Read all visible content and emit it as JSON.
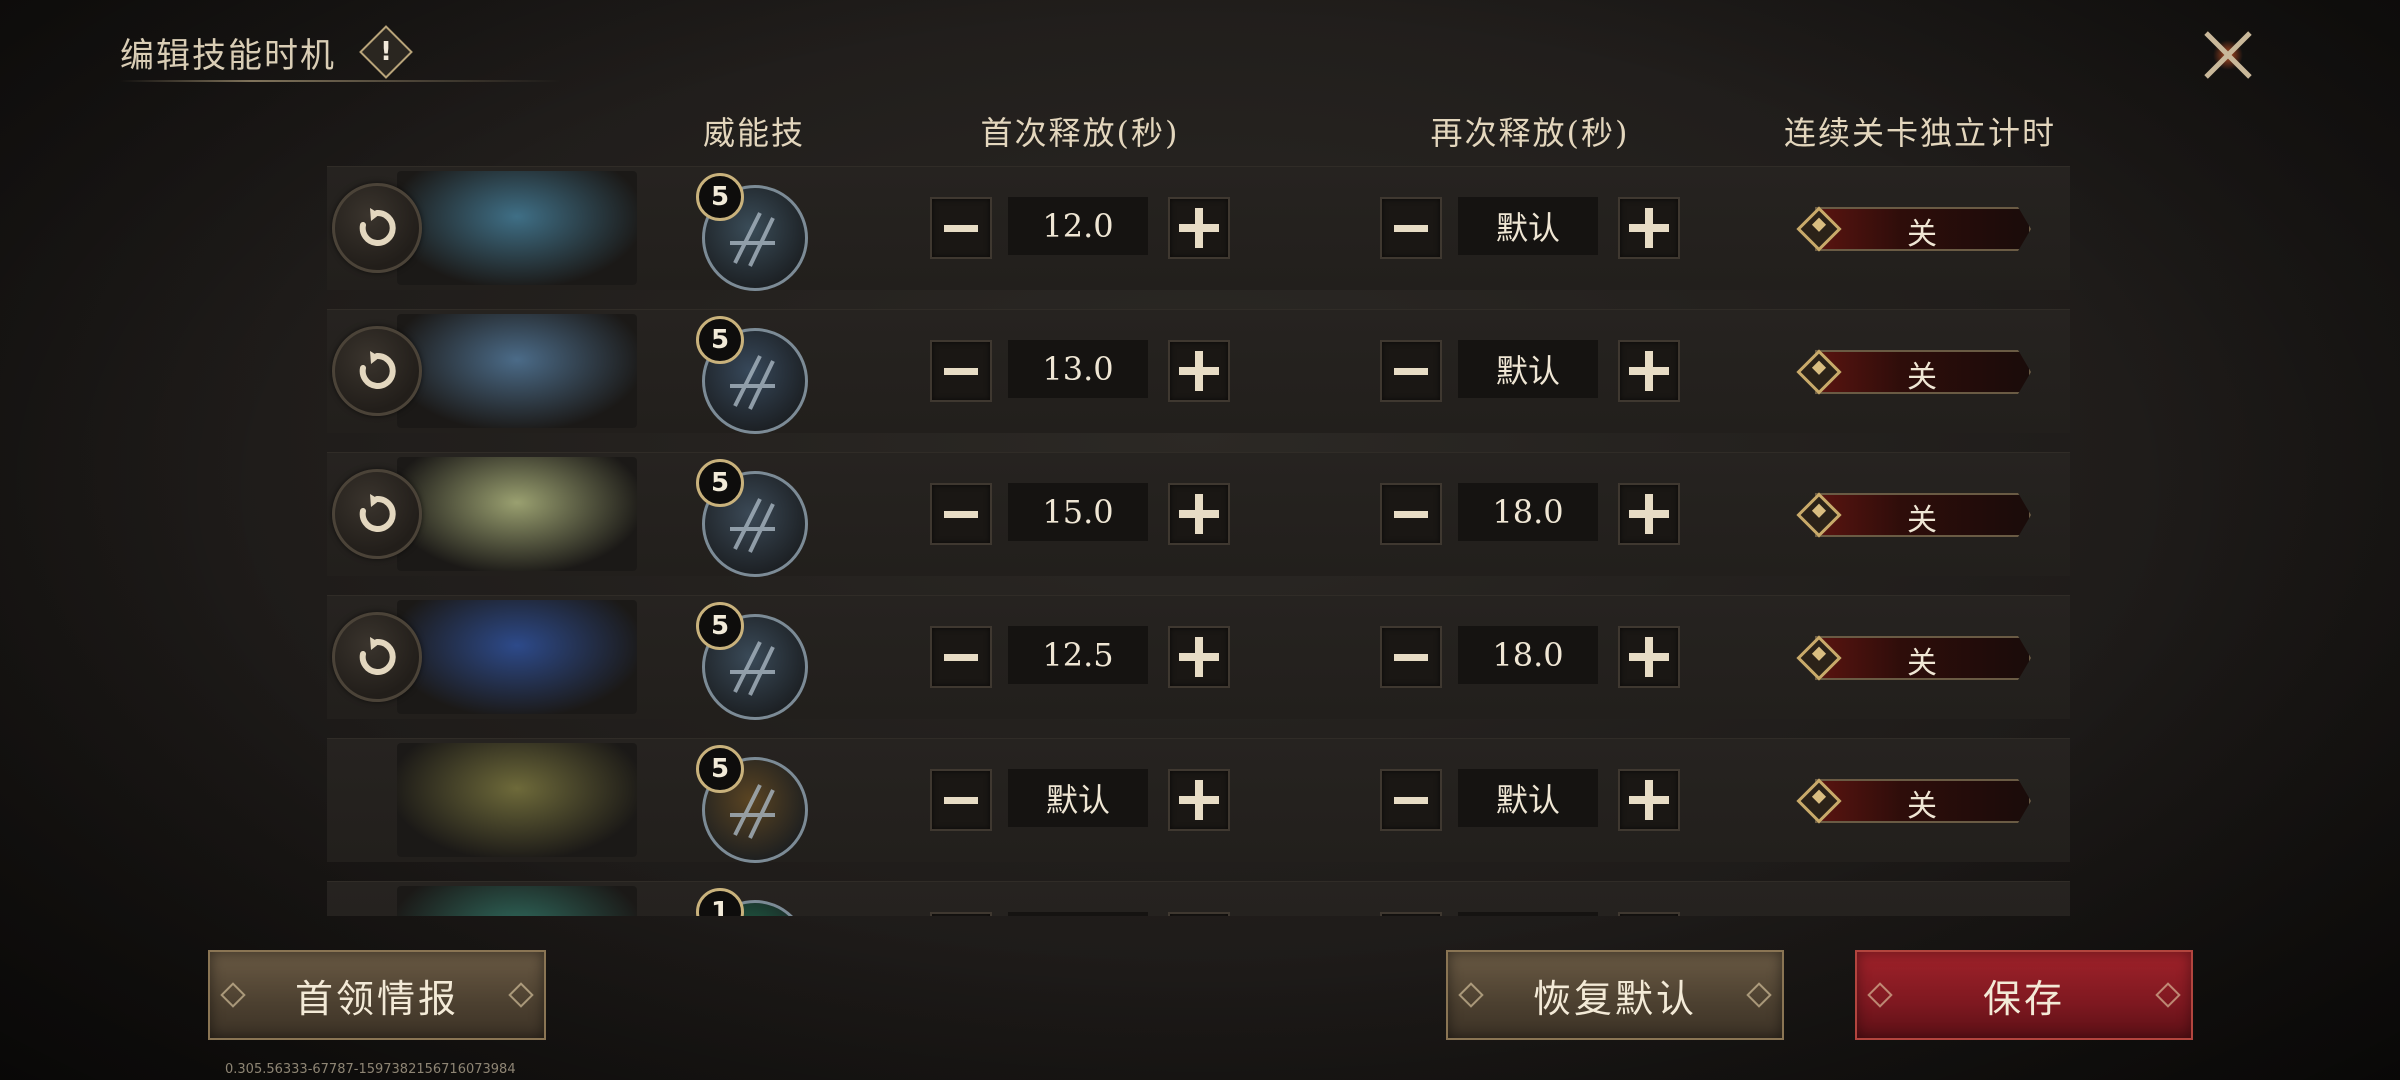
{
  "header": {
    "title": "编辑技能时机",
    "info_mark": "!"
  },
  "columns": {
    "skill": "威能技",
    "first_cast": "首次释放(秒)",
    "recast": "再次释放(秒)",
    "continuous_timer": "连续关卡独立计时"
  },
  "rows": [
    {
      "skill_level": "5",
      "first": "12.0",
      "recast": "默认",
      "toggle": "关",
      "has_reset": true,
      "portrait_color": "#3f6f86",
      "skill_color": "#3a4c58"
    },
    {
      "skill_level": "5",
      "first": "13.0",
      "recast": "默认",
      "toggle": "关",
      "has_reset": true,
      "portrait_color": "#4b6b88",
      "skill_color": "#37485a"
    },
    {
      "skill_level": "5",
      "first": "15.0",
      "recast": "18.0",
      "toggle": "关",
      "has_reset": true,
      "portrait_color": "#9aa070",
      "skill_color": "#3b4956"
    },
    {
      "skill_level": "5",
      "first": "12.5",
      "recast": "18.0",
      "toggle": "关",
      "has_reset": true,
      "portrait_color": "#2d4a8a",
      "skill_color": "#3a4a58"
    },
    {
      "skill_level": "5",
      "first": "默认",
      "recast": "默认",
      "toggle": "关",
      "has_reset": false,
      "portrait_color": "#6e6a3a",
      "skill_color": "#5a4422"
    },
    {
      "skill_level": "1",
      "first": "",
      "recast": "",
      "toggle": "",
      "has_reset": false,
      "portrait_color": "#2f6b5e",
      "skill_color": "#1f6a4a"
    }
  ],
  "buttons": {
    "boss_info": "首领情报",
    "restore_default": "恢复默认",
    "save": "保存"
  },
  "version": "0.305.56333-67787-1597382156716073984",
  "colors": {
    "accent_red": "#8f1c22",
    "accent_gold": "#c9b27c",
    "text": "#efe6d4"
  }
}
